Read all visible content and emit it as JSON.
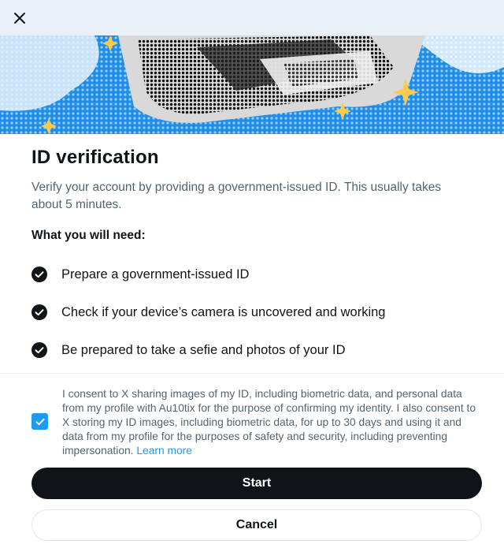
{
  "dialog": {
    "close_icon": "close-icon",
    "title": "ID verification",
    "description": "Verify your account by providing a government-issued ID. This usually takes about 5 minutes.",
    "need_heading": "What you will need:",
    "requirements": [
      "Prepare a government-issued ID",
      "Check if your device’s camera is uncovered and working",
      "Be prepared to take a sefie and photos of your ID"
    ],
    "consent": {
      "checked": true,
      "text": "I consent to X sharing images of my ID, including biometric data, and personal data from my profile with Au10tix for the purpose of confirming my identity. I also consent to X storing my ID images, including biometric data, for up to 30 days and using it and data from my profile for the purposes of safety and security, including preventing impersonation.",
      "link": "Learn more"
    },
    "start_label": "Start",
    "cancel_label": "Cancel"
  },
  "colors": {
    "accent": "#1d9bf0",
    "primary_button": "#0f1419",
    "muted_text": "#536471"
  }
}
